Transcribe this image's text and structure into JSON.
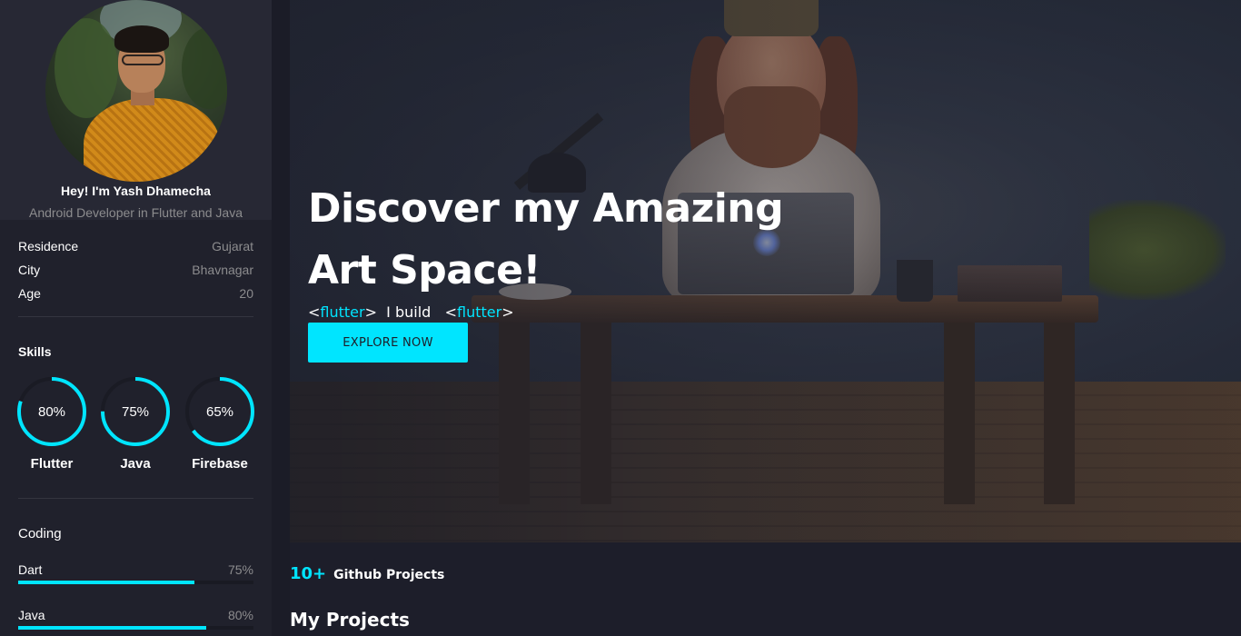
{
  "profile": {
    "name": "Hey! I'm Yash Dhamecha",
    "role": "Android Developer in Flutter and Java"
  },
  "info": [
    {
      "label": "Residence",
      "value": "Gujarat"
    },
    {
      "label": "City",
      "value": "Bhavnagar"
    },
    {
      "label": "Age",
      "value": "20"
    }
  ],
  "skills": {
    "title": "Skills",
    "items": [
      {
        "name": "Flutter",
        "percent_label": "80%",
        "percent": 80
      },
      {
        "name": "Java",
        "percent_label": "75%",
        "percent": 75
      },
      {
        "name": "Firebase",
        "percent_label": "65%",
        "percent": 65
      }
    ]
  },
  "coding": {
    "title": "Coding",
    "items": [
      {
        "name": "Dart",
        "percent_label": "75%",
        "percent": 75
      },
      {
        "name": "Java",
        "percent_label": "80%",
        "percent": 80
      }
    ]
  },
  "hero": {
    "title_line1": "Discover my Amazing",
    "title_line2": "Art Space!",
    "code_open": "<",
    "code_tag": "flutter",
    "code_close": ">",
    "code_middle": "I build",
    "code_open2": "<",
    "code_tag2": "flutter",
    "code_close2": ">",
    "cta_label": "EXPLORE NOW"
  },
  "stats": {
    "github_count": "10+",
    "github_label": "Github Projects"
  },
  "projects": {
    "title": "My Projects"
  },
  "colors": {
    "accent": "#00e5ff",
    "background": "#1d1e2a",
    "sidebar": "#20212c",
    "profile_panel": "#272834",
    "muted_text": "#8c8c8e"
  }
}
